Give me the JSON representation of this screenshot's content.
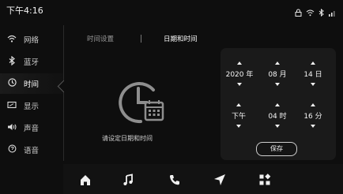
{
  "status_bar": {
    "time": "下午4:16",
    "icons": [
      "lock-icon",
      "wifi-icon",
      "bluetooth-icon",
      "signal-icon"
    ]
  },
  "sidebar": {
    "items": [
      {
        "icon": "wifi-icon",
        "label": "网络"
      },
      {
        "icon": "bluetooth-icon",
        "label": "蓝牙"
      },
      {
        "icon": "clock-icon",
        "label": "时间",
        "active": true
      },
      {
        "icon": "display-icon",
        "label": "显示"
      },
      {
        "icon": "speaker-icon",
        "label": "声音"
      },
      {
        "icon": "language-icon",
        "label": "语音"
      }
    ]
  },
  "tabs": [
    {
      "label": "时间设置",
      "active": false
    },
    {
      "label": "日期和时间",
      "active": true
    }
  ],
  "main": {
    "hint_text": "请设定日期和时间"
  },
  "picker": {
    "year": "2020 年",
    "month": "08 月",
    "day": "14 日",
    "ampm": "下午",
    "hour": "04 时",
    "minute": "16 分",
    "save_label": "保存"
  },
  "dock": {
    "items": [
      "home-icon",
      "music-icon",
      "phone-icon",
      "navigation-icon",
      "apps-icon"
    ]
  }
}
